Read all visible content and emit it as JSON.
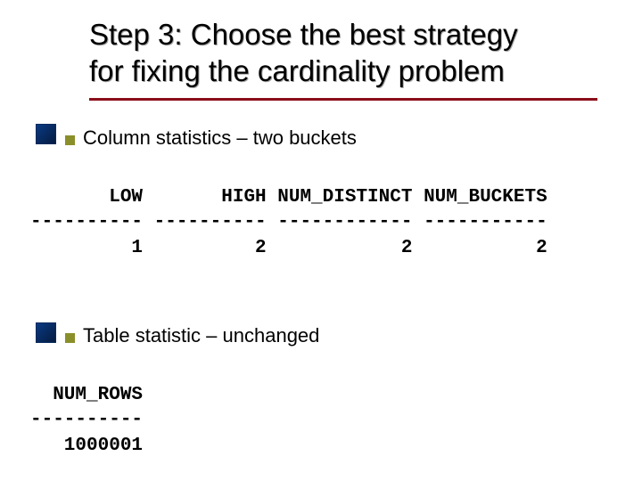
{
  "title_line1": "Step 3:  Choose the best strategy",
  "title_line2": "for fixing the cardinality problem",
  "bullets": {
    "b1": "Column statistics – two buckets",
    "b2": "Table statistic – unchanged"
  },
  "table1": {
    "header": "       LOW       HIGH NUM_DISTINCT NUM_BUCKETS",
    "divider": "---------- ---------- ------------ -----------",
    "row": "         1          2            2           2"
  },
  "table2": {
    "header": "  NUM_ROWS",
    "divider": "----------",
    "row": "   1000001"
  },
  "chart_data": {
    "type": "table",
    "tables": [
      {
        "columns": [
          "LOW",
          "HIGH",
          "NUM_DISTINCT",
          "NUM_BUCKETS"
        ],
        "rows": [
          [
            1,
            2,
            2,
            2
          ]
        ]
      },
      {
        "columns": [
          "NUM_ROWS"
        ],
        "rows": [
          [
            1000001
          ]
        ]
      }
    ]
  }
}
